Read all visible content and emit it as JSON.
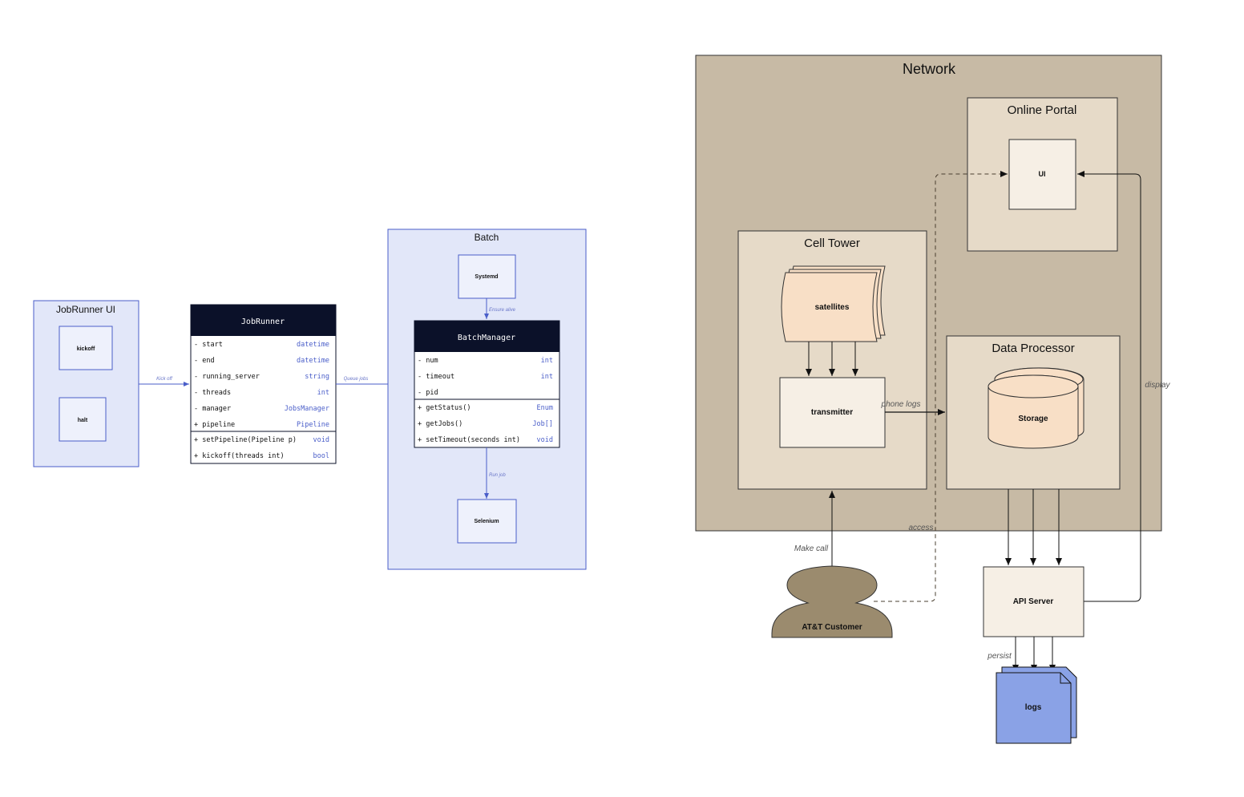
{
  "left": {
    "jobrunner_ui": {
      "title": "JobRunner UI",
      "kickoff": "kickoff",
      "halt": "halt"
    },
    "jobrunner": {
      "title": "JobRunner",
      "fields": [
        {
          "vis": "-",
          "name": "start",
          "type": "datetime"
        },
        {
          "vis": "-",
          "name": "end",
          "type": "datetime"
        },
        {
          "vis": "-",
          "name": "running_server",
          "type": "string"
        },
        {
          "vis": "-",
          "name": "threads",
          "type": "int"
        },
        {
          "vis": "-",
          "name": "manager",
          "type": "JobsManager"
        },
        {
          "vis": "+",
          "name": "pipeline",
          "type": "Pipeline"
        }
      ],
      "methods": [
        {
          "vis": "+",
          "name": "setPipeline(Pipeline p)",
          "type": "void"
        },
        {
          "vis": "+",
          "name": "kickoff(threads int)",
          "type": "bool"
        }
      ]
    },
    "batch": {
      "title": "Batch",
      "systemd": "Systemd",
      "selenium": "Selenium",
      "manager": {
        "title": "BatchManager",
        "fields": [
          {
            "vis": "-",
            "name": "num",
            "type": "int"
          },
          {
            "vis": "-",
            "name": "timeout",
            "type": "int"
          },
          {
            "vis": "-",
            "name": "pid",
            "type": ""
          }
        ],
        "methods": [
          {
            "vis": "+",
            "name": "getStatus()",
            "type": "Enum"
          },
          {
            "vis": "+",
            "name": "getJobs()",
            "type": "Job[]"
          },
          {
            "vis": "+",
            "name": "setTimeout(seconds int)",
            "type": "void"
          }
        ]
      }
    },
    "edges": {
      "kick_off": "Kick off",
      "queue_jobs": "Queue jobs",
      "ensure_alive": "Ensure alive",
      "run_job": "Run job"
    }
  },
  "right": {
    "network": "Network",
    "online_portal": "Online Portal",
    "ui": "UI",
    "cell_tower": "Cell Tower",
    "satellites": "satellites",
    "transmitter": "transmitter",
    "data_processor": "Data Processor",
    "storage": "Storage",
    "customer": "AT&T Customer",
    "api_server": "API Server",
    "logs": "logs",
    "edges": {
      "phone_logs": "phone logs",
      "display": "display",
      "access": "access",
      "make_call": "Make call",
      "persist": "persist"
    }
  },
  "colors": {
    "blue_fill": "#e2e7f9",
    "blue_stroke": "#4a5ec9",
    "navy": "#0b1129",
    "network_fill": "#c7baa5",
    "inner_fill": "#e6dac8",
    "leaf_fill": "#f6efe5",
    "peach": "#f8dfc6",
    "customer": "#9b8b6e",
    "logs": "#8aa2e6"
  }
}
